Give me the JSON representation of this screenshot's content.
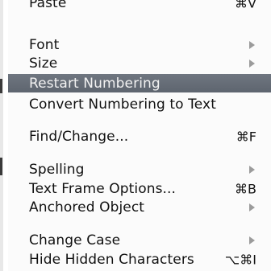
{
  "menu": {
    "items": [
      {
        "label": "Paste",
        "shortcut": "⌘V"
      },
      {
        "label": "Font",
        "shortcut": ""
      },
      {
        "label": "Size",
        "shortcut": ""
      },
      {
        "label": "Restart Numbering",
        "shortcut": ""
      },
      {
        "label": "Convert Numbering to Text",
        "shortcut": ""
      },
      {
        "label": "Find/Change...",
        "shortcut": "⌘F"
      },
      {
        "label": "Spelling",
        "shortcut": ""
      },
      {
        "label": "Text Frame Options...",
        "shortcut": "⌘B"
      },
      {
        "label": "Anchored Object",
        "shortcut": ""
      },
      {
        "label": "Change Case",
        "shortcut": ""
      },
      {
        "label": "Hide Hidden Characters",
        "shortcut": "⌥⌘I"
      }
    ],
    "highlight_color": "#666d77",
    "submenu_arrow_color": "#9b9b9b"
  }
}
